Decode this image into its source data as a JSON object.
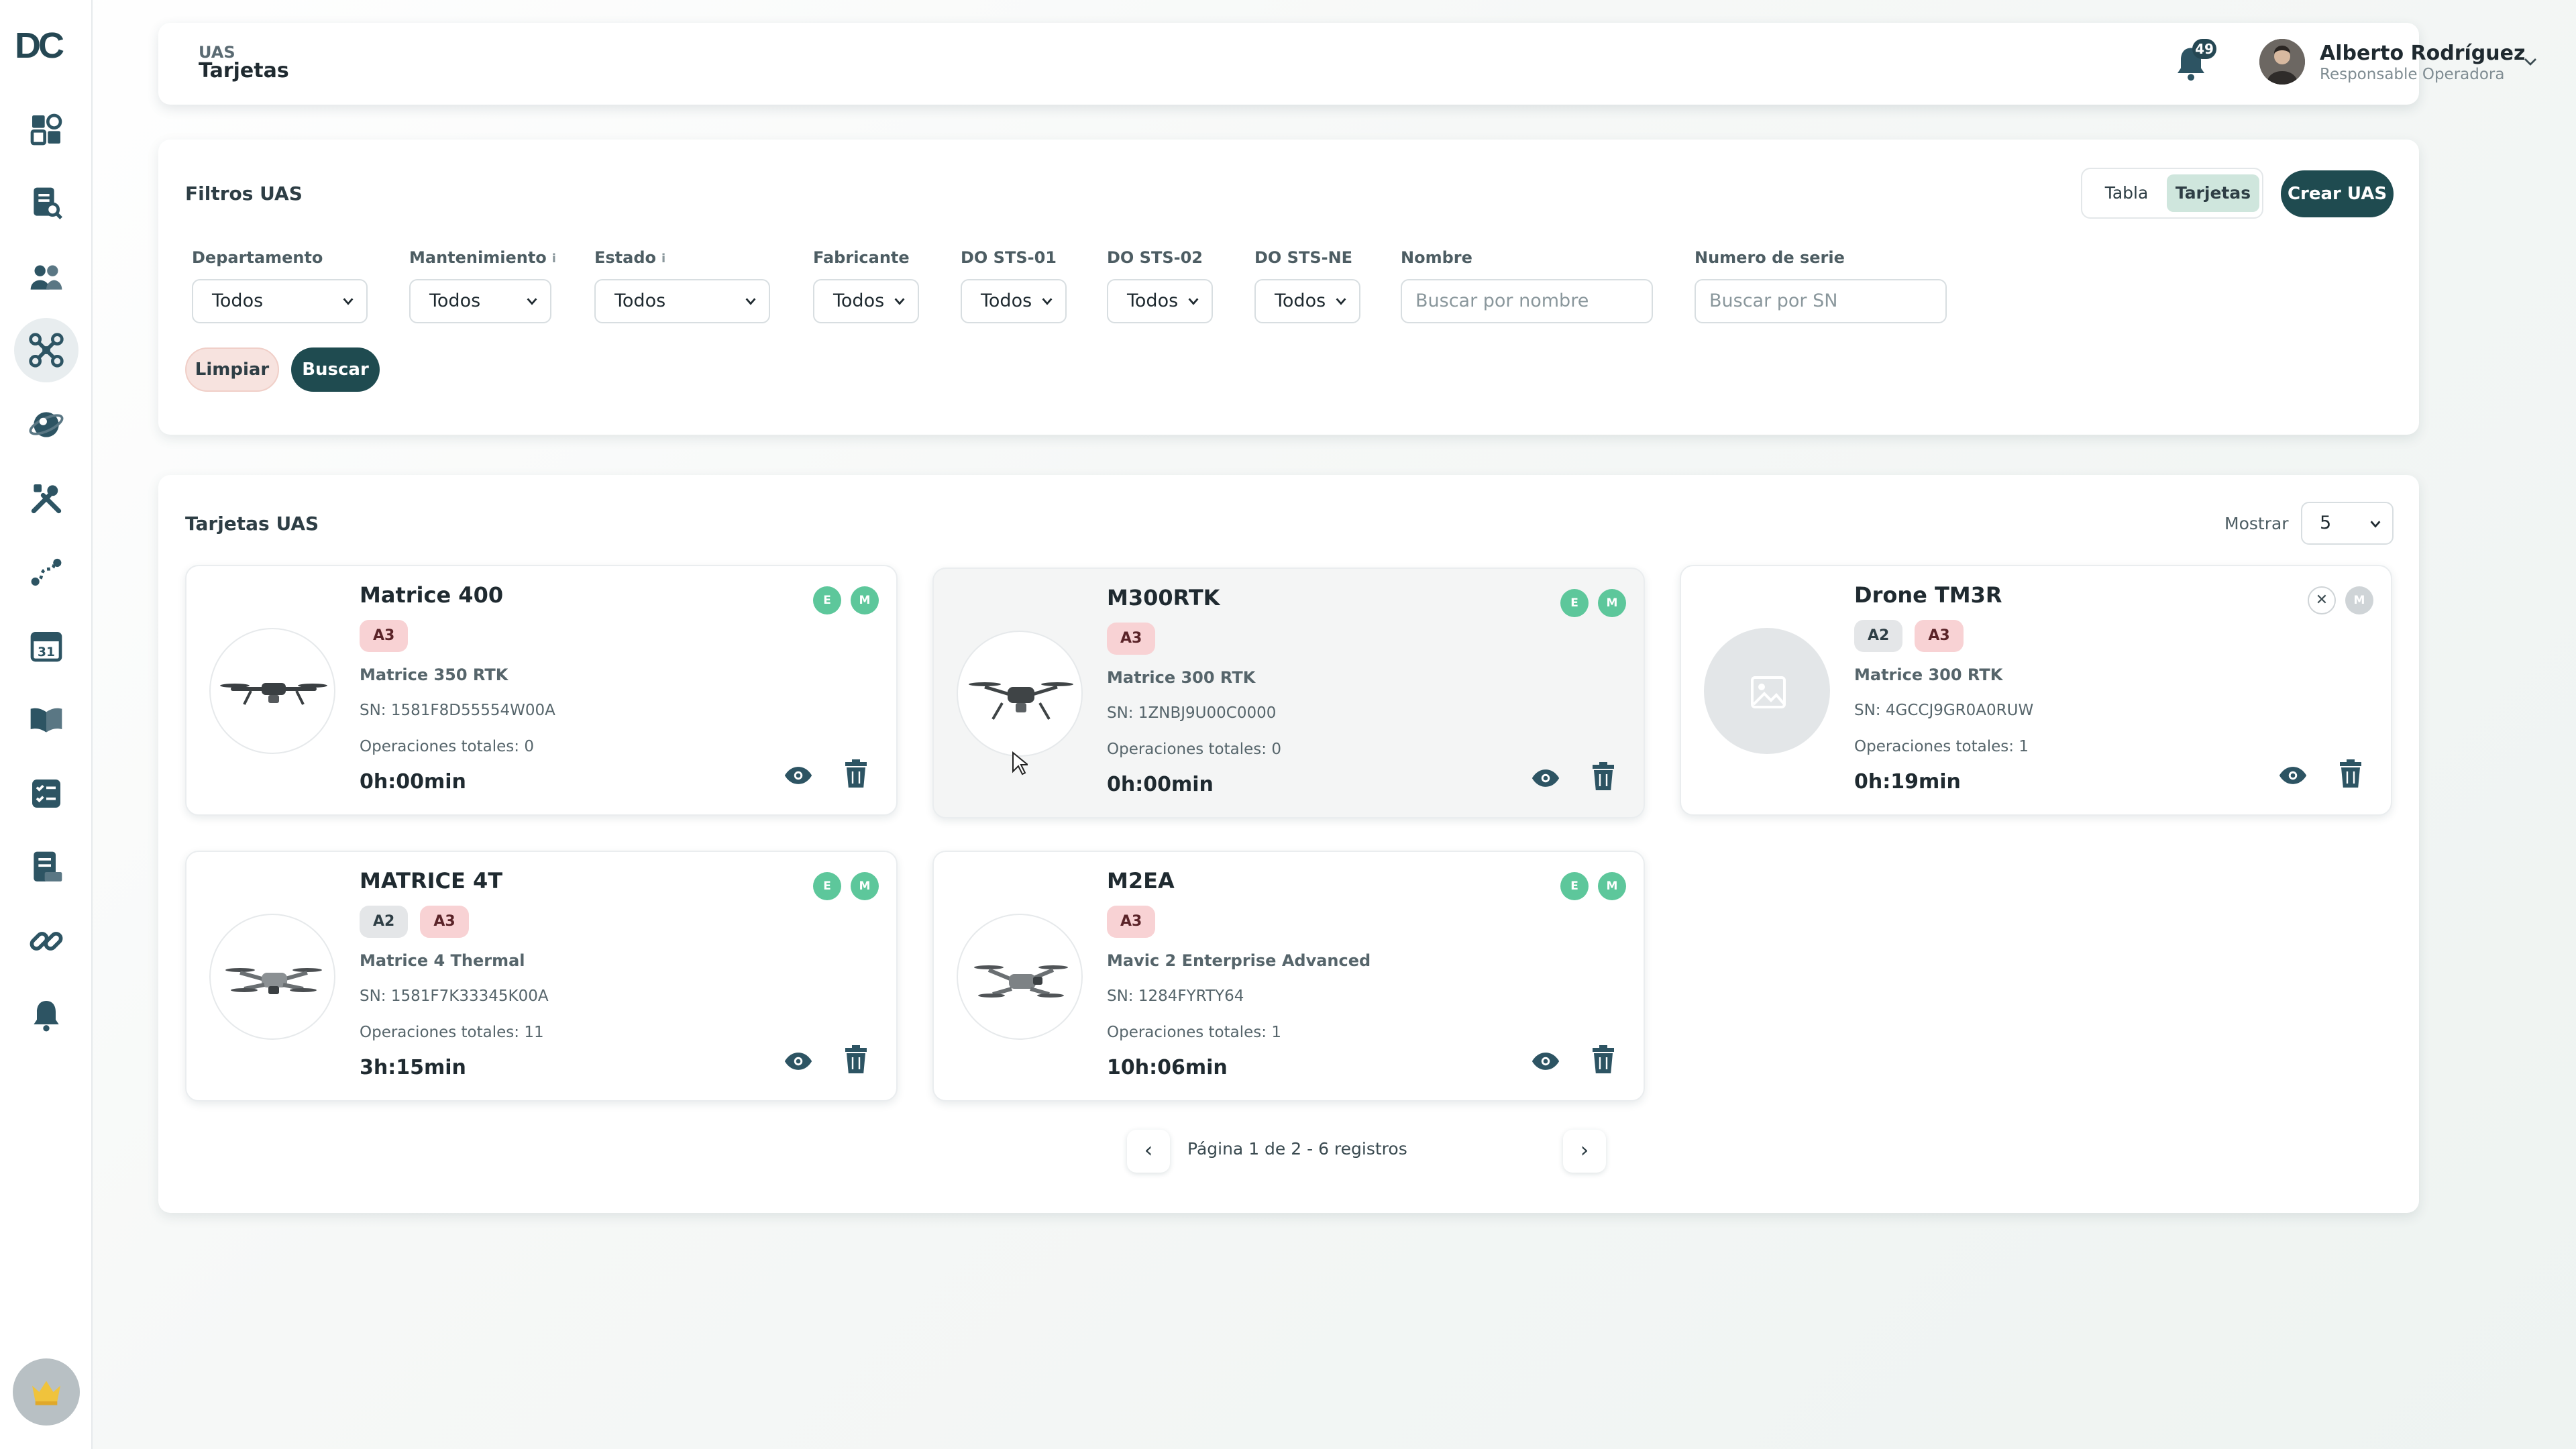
{
  "sidebar": {
    "logo": "DC",
    "items": [
      {
        "icon": "dashboard-icon"
      },
      {
        "icon": "document-search-icon"
      },
      {
        "icon": "users-icon"
      },
      {
        "icon": "drone-icon",
        "active": true
      },
      {
        "icon": "globe-icon"
      },
      {
        "icon": "tools-icon"
      },
      {
        "icon": "route-icon"
      },
      {
        "icon": "calendar-icon",
        "text": "31"
      },
      {
        "icon": "book-icon"
      },
      {
        "icon": "checklist-icon"
      },
      {
        "icon": "report-icon"
      },
      {
        "icon": "link-icon"
      },
      {
        "icon": "bell-icon"
      }
    ],
    "bottom_icon": "crown-icon"
  },
  "header": {
    "section": "UAS",
    "title": "Tarjetas",
    "notifications": "49",
    "user_name": "Alberto Rodríguez",
    "user_role": "Responsable Operadora"
  },
  "filters": {
    "title": "Filtros UAS",
    "view_table": "Tabla",
    "view_cards": "Tarjetas",
    "create_button": "Crear UAS",
    "fields": {
      "departamento": {
        "label": "Departamento",
        "value": "Todos"
      },
      "mantenimiento": {
        "label": "Mantenimiento",
        "value": "Todos",
        "info": "i"
      },
      "estado": {
        "label": "Estado",
        "value": "Todos",
        "info": "i"
      },
      "fabricante": {
        "label": "Fabricante",
        "value": "Todos"
      },
      "do_sts_01": {
        "label": "DO STS-01",
        "value": "Todos"
      },
      "do_sts_02": {
        "label": "DO STS-02",
        "value": "Todos"
      },
      "do_sts_ne": {
        "label": "DO STS-NE",
        "value": "Todos"
      },
      "nombre": {
        "label": "Nombre",
        "placeholder": "Buscar por nombre"
      },
      "numero_serie": {
        "label": "Numero de serie",
        "placeholder": "Buscar por SN"
      }
    },
    "clear_button": "Limpiar",
    "search_button": "Buscar"
  },
  "cards_panel": {
    "title": "Tarjetas UAS",
    "show_label": "Mostrar",
    "show_value": "5",
    "cards": [
      {
        "name": "Matrice 400",
        "tags": [
          "A3"
        ],
        "model": "Matrice 350 RTK",
        "sn": "SN: 1581F8D55554W00A",
        "ops": "Operaciones totales: 0",
        "time": "0h:00min",
        "status": [
          {
            "text": "E",
            "state": "on"
          },
          {
            "text": "M",
            "state": "on"
          }
        ]
      },
      {
        "name": "M300RTK",
        "tags": [
          "A3"
        ],
        "model": "Matrice 300 RTK",
        "sn": "SN: 1ZNBJ9U00C0000",
        "ops": "Operaciones totales: 0",
        "time": "0h:00min",
        "status": [
          {
            "text": "E",
            "state": "on"
          },
          {
            "text": "M",
            "state": "on"
          }
        ]
      },
      {
        "name": "Drone TM3R",
        "tags": [
          "A2",
          "A3"
        ],
        "model": "Matrice 300 RTK",
        "sn": "SN: 4GCCJ9GR0A0RUW",
        "ops": "Operaciones totales: 1",
        "time": "0h:19min",
        "status": [
          {
            "text": "✕",
            "state": "x"
          },
          {
            "text": "M",
            "state": "off"
          }
        ]
      },
      {
        "name": "MATRICE 4T",
        "tags": [
          "A2",
          "A3"
        ],
        "model": "Matrice 4 Thermal",
        "sn": "SN: 1581F7K33345K00A",
        "ops": "Operaciones totales: 11",
        "time": "3h:15min",
        "status": [
          {
            "text": "E",
            "state": "on"
          },
          {
            "text": "M",
            "state": "on"
          }
        ]
      },
      {
        "name": "M2EA",
        "tags": [
          "A3"
        ],
        "model": "Mavic 2 Enterprise Advanced",
        "sn": "SN: 1284FYRTY64",
        "ops": "Operaciones totales: 1",
        "time": "10h:06min",
        "status": [
          {
            "text": "E",
            "state": "on"
          },
          {
            "text": "M",
            "state": "on"
          }
        ]
      }
    ],
    "pagination": {
      "text": "Página 1 de 2 - 6 registros",
      "prev": "‹",
      "next": "›"
    }
  },
  "colors": {
    "primary": "#1f4b50",
    "status_on": "#5dc79b",
    "tag_a3": "#f8d2d4",
    "tag_a2": "#e4e6e8"
  }
}
